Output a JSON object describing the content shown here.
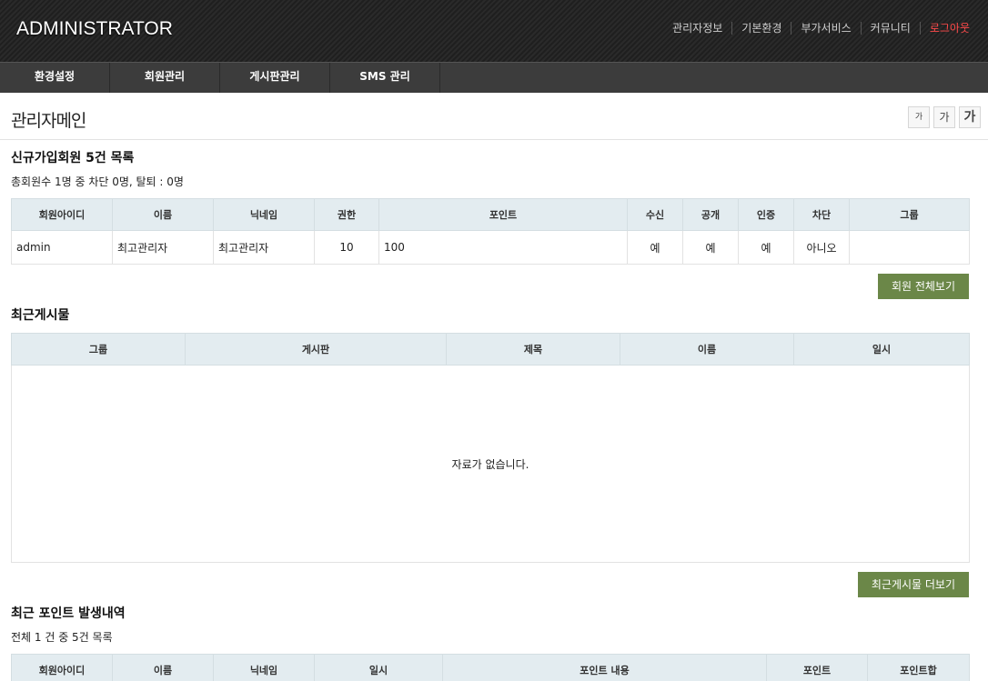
{
  "header": {
    "logo": "ADMINISTRATOR",
    "links": [
      "관리자정보",
      "기본환경",
      "부가서비스",
      "커뮤니티"
    ],
    "logout": "로그아웃"
  },
  "gnb": {
    "items": [
      "환경설정",
      "회원관리",
      "게시판관리",
      "SMS 관리"
    ]
  },
  "page": {
    "title": "관리자메인",
    "font_buttons": [
      "가",
      "가",
      "가"
    ]
  },
  "new_members": {
    "title": "신규가입회원 5건 목록",
    "summary": "총회원수 1명 중 차단 0명, 탈퇴 : 0명",
    "headers": [
      "회원아이디",
      "이름",
      "닉네임",
      "권한",
      "포인트",
      "수신",
      "공개",
      "인증",
      "차단",
      "그룹"
    ],
    "rows": [
      [
        "admin",
        "최고관리자",
        "최고관리자",
        "10",
        "100",
        "예",
        "예",
        "예",
        "아니오",
        ""
      ]
    ],
    "button": "회원 전체보기"
  },
  "recent_posts": {
    "title": "최근게시물",
    "headers": [
      "그룹",
      "게시판",
      "제목",
      "이름",
      "일시"
    ],
    "empty": "자료가 없습니다.",
    "button": "최근게시물 더보기"
  },
  "recent_points": {
    "title": "최근 포인트 발생내역",
    "summary": "전체 1 건 중 5건 목록",
    "headers": [
      "회원아이디",
      "이름",
      "닉네임",
      "일시",
      "포인트 내용",
      "포인트",
      "포인트합"
    ]
  },
  "colors": {
    "header_bg": "#252525",
    "gnb_bg": "#3c3c3c",
    "logout": "#ff4a4a",
    "table_head": "#e3ecf0",
    "button_green": "#6b8748"
  }
}
